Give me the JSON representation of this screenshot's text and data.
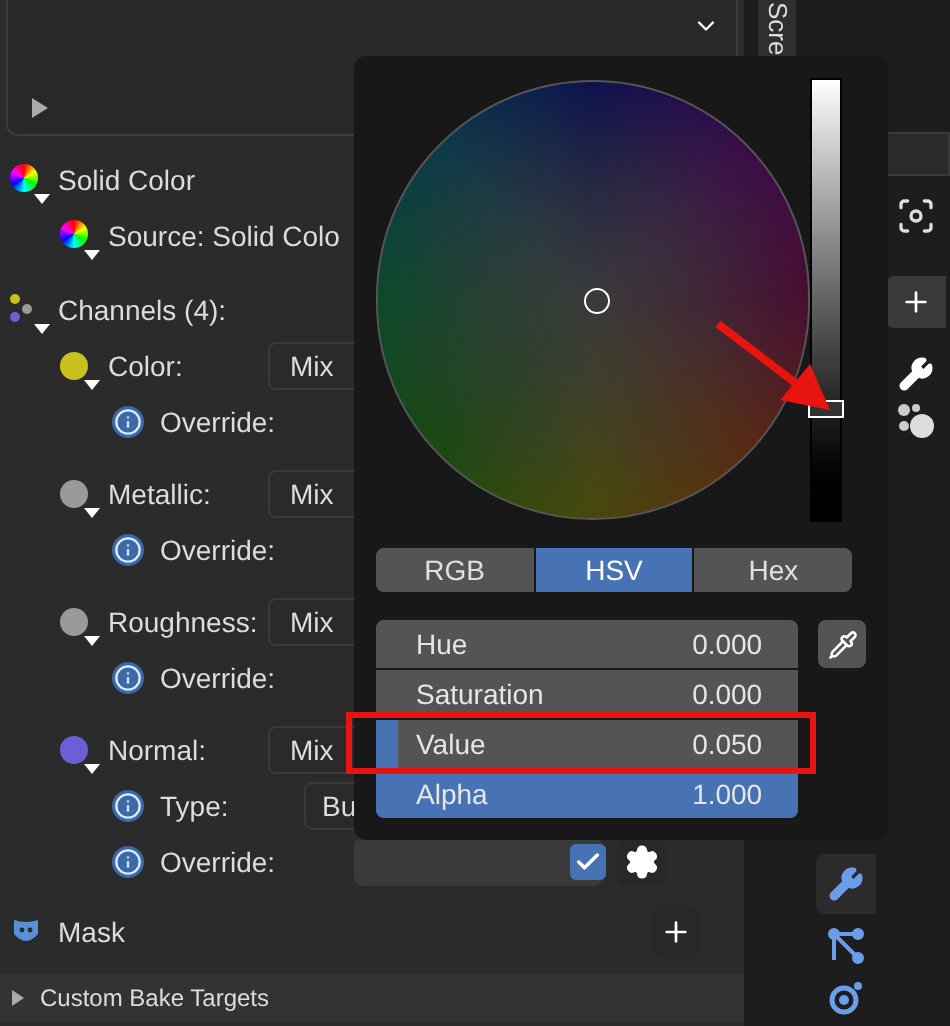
{
  "vertical_tab": "Scre",
  "solid_color": {
    "label": "Solid Color",
    "children": [
      {
        "label": "Source: Solid Colo"
      }
    ]
  },
  "channels": {
    "label": "Channels (4):",
    "items": [
      {
        "label": "Color:",
        "color": "#c8c01c",
        "dropdown": "Mix",
        "children": [
          {
            "kind": "override",
            "label": "Override:"
          }
        ]
      },
      {
        "label": "Metallic:",
        "color": "#9a9a9a",
        "dropdown": "Mix",
        "children": [
          {
            "kind": "override",
            "label": "Override:"
          }
        ]
      },
      {
        "label": "Roughness:",
        "color": "#9a9a9a",
        "dropdown": "Mix",
        "children": [
          {
            "kind": "override",
            "label": "Override:"
          }
        ]
      },
      {
        "label": "Normal:",
        "color": "#6b5fd6",
        "dropdown": "Mix",
        "children": [
          {
            "kind": "type",
            "label": "Type:",
            "value": "Bu"
          },
          {
            "kind": "override",
            "label": "Override:",
            "checked": true
          }
        ]
      }
    ]
  },
  "mask": {
    "label": "Mask"
  },
  "footer": "Custom Bake Targets",
  "color_picker": {
    "value_slider": {
      "level": 0.25
    },
    "modes": [
      {
        "label": "RGB",
        "selected": false
      },
      {
        "label": "HSV",
        "selected": true
      },
      {
        "label": "Hex",
        "selected": false
      }
    ],
    "fields": [
      {
        "label": "Hue",
        "value": "0.000"
      },
      {
        "label": "Saturation",
        "value": "0.000"
      },
      {
        "label": "Value",
        "value": "0.050",
        "level": 0.05
      },
      {
        "label": "Alpha",
        "value": "1.000",
        "level": 1
      }
    ]
  }
}
